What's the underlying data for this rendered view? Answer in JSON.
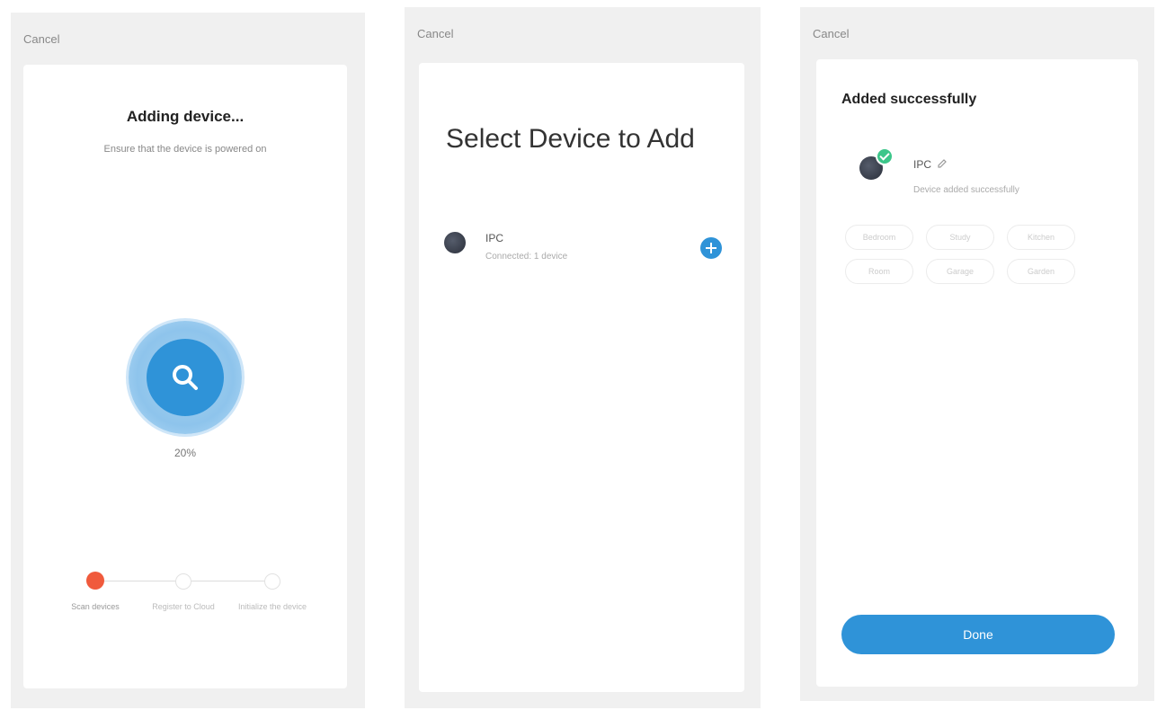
{
  "screen1": {
    "cancel": "Cancel",
    "title": "Adding device...",
    "subtitle": "Ensure that the device is powered on",
    "progress": "20%",
    "steps": [
      {
        "label": "Scan devices",
        "state": "active"
      },
      {
        "label": "Register to Cloud",
        "state": "pending"
      },
      {
        "label": "Initialize the device",
        "state": "pending"
      }
    ],
    "icon": "search-icon"
  },
  "screen2": {
    "cancel": "Cancel",
    "title": "Select Device to Add",
    "device": {
      "name": "IPC",
      "status": "Connected: 1 device"
    }
  },
  "screen3": {
    "cancel": "Cancel",
    "title": "Added successfully",
    "device": {
      "name": "IPC",
      "status": "Device added successfully"
    },
    "rooms": [
      "Bedroom",
      "Study",
      "Kitchen",
      "Room",
      "Garage",
      "Garden"
    ],
    "done": "Done"
  },
  "colors": {
    "accent": "#2f93d8",
    "active_step": "#f05a3c",
    "success": "#3cc68a"
  }
}
